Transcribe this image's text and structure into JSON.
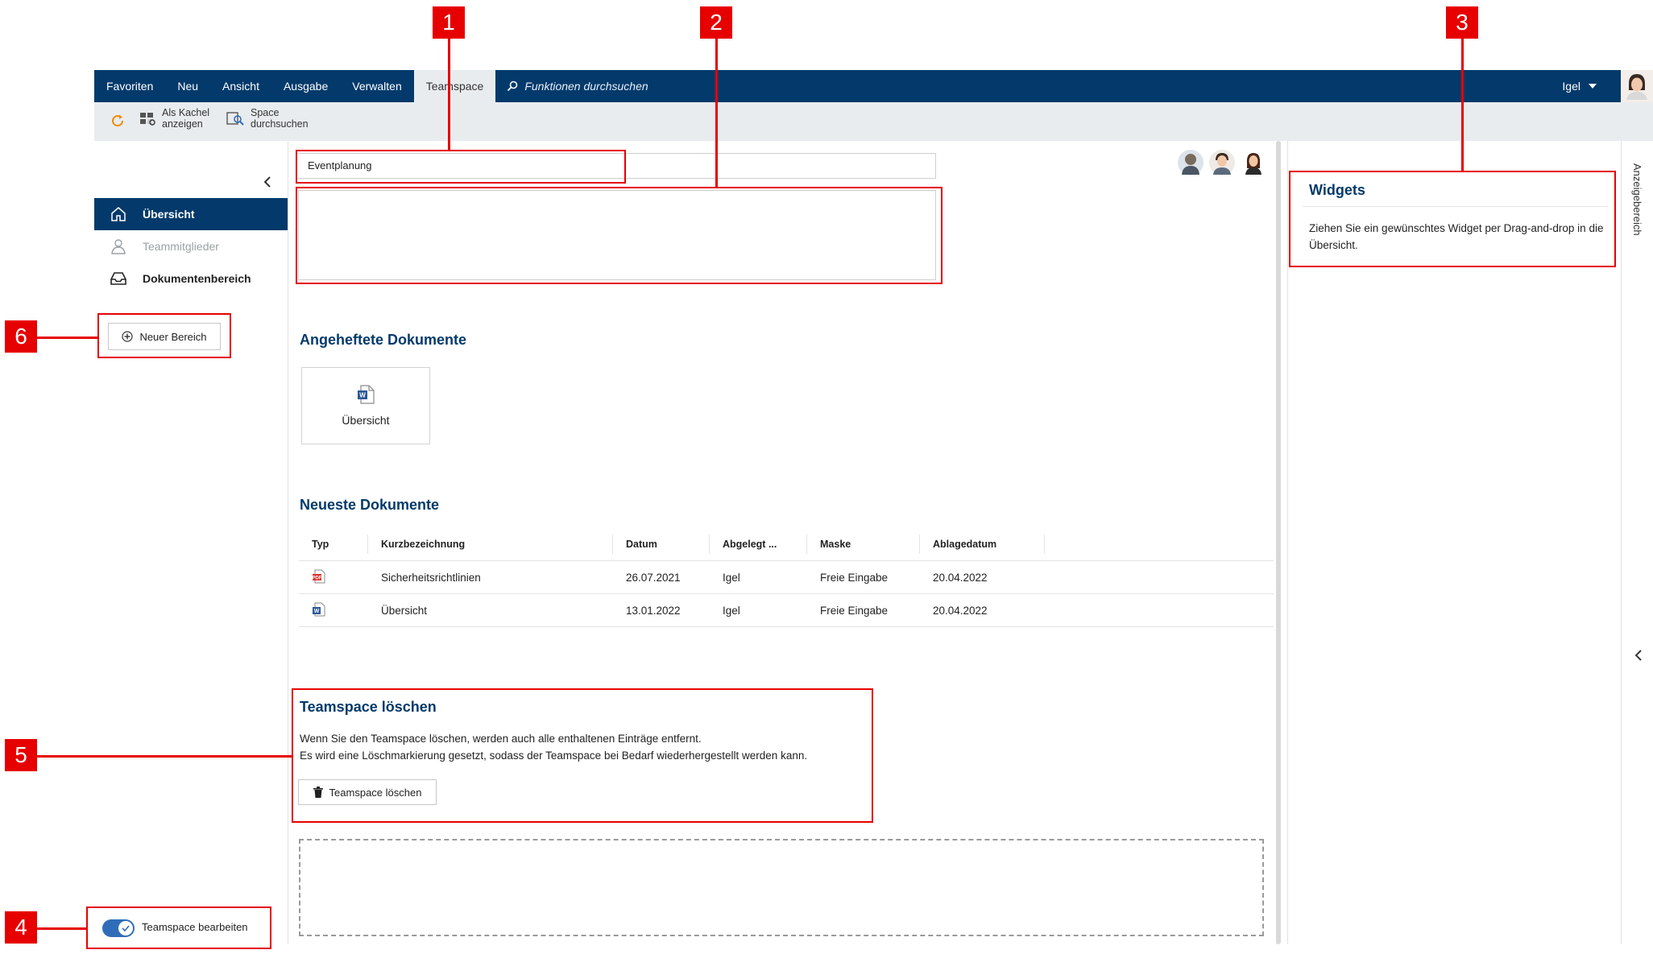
{
  "menubar": {
    "items": [
      "Favoriten",
      "Neu",
      "Ansicht",
      "Ausgabe",
      "Verwalten",
      "Teamspace"
    ],
    "active_index": 5,
    "search_placeholder": "Funktionen durchsuchen",
    "user_name": "Igel"
  },
  "ribbon": {
    "refresh_icon": "refresh-icon",
    "tile_view_line1": "Als Kachel",
    "tile_view_line2": "anzeigen",
    "search_space_line1": "Space",
    "search_space_line2": "durchsuchen"
  },
  "sidebar": {
    "items": [
      {
        "label": "Übersicht",
        "icon": "home-icon",
        "state": "active"
      },
      {
        "label": "Teammitglieder",
        "icon": "user-icon",
        "state": "disabled"
      },
      {
        "label": "Dokumentenbereich",
        "icon": "inbox-icon",
        "state": "normal"
      }
    ],
    "new_area_label": "Neuer Bereich",
    "edit_toggle_label": "Teamspace bearbeiten",
    "edit_toggle_on": true
  },
  "main": {
    "title_value": "Eventplanung",
    "pinned_title": "Angeheftete Dokumente",
    "pinned_tile_label": "Übersicht",
    "recent_title": "Neueste Dokumente",
    "columns": [
      "Typ",
      "Kurzbezeichnung",
      "Datum",
      "Abgelegt ...",
      "Maske",
      "Ablagedatum"
    ],
    "rows": [
      {
        "type": "pdf",
        "name": "Sicherheitsrichtlinien",
        "date": "26.07.2021",
        "by": "Igel",
        "mask": "Freie Eingabe",
        "filed": "20.04.2022"
      },
      {
        "type": "word",
        "name": "Übersicht",
        "date": "13.01.2022",
        "by": "Igel",
        "mask": "Freie Eingabe",
        "filed": "20.04.2022"
      }
    ],
    "delete_title": "Teamspace löschen",
    "delete_text_1": "Wenn Sie den Teamspace löschen, werden auch alle enthaltenen Einträge entfernt.",
    "delete_text_2": "Es wird eine Löschmarkierung gesetzt, sodass der Teamspace bei Bedarf wiederhergestellt werden kann.",
    "delete_button": "Teamspace löschen"
  },
  "widgets": {
    "title": "Widgets",
    "text": "Ziehen Sie ein gewünschtes Widget per Drag-and-drop in die Übersicht.",
    "side_tab_label": "Anzeigebereich"
  },
  "annotations": [
    "1",
    "2",
    "3",
    "4",
    "5",
    "6"
  ],
  "colors": {
    "accent": "#033a6b",
    "annotation": "#e60000",
    "ribbon_bg": "#e9ecef"
  }
}
